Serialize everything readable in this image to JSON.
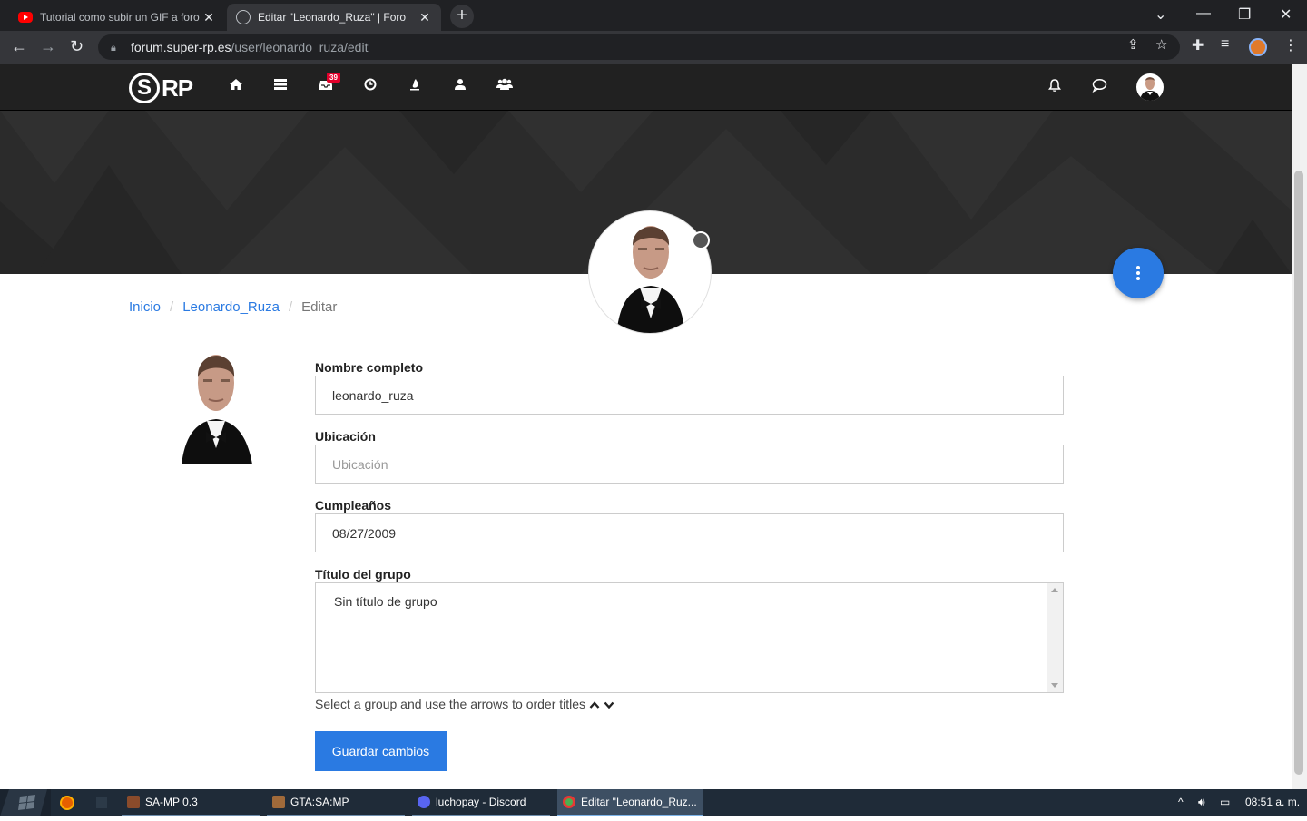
{
  "browser": {
    "tabs": [
      {
        "title": "Tutorial como subir un GIF a foro",
        "active": false
      },
      {
        "title": "Editar \"Leonardo_Ruza\" | Foro",
        "active": true
      }
    ],
    "url_host": "forum.super-rp.es",
    "url_path": "/user/leonardo_ruza/edit"
  },
  "header": {
    "logo_s": "S",
    "logo_rp": "RP",
    "notifications_badge": "39"
  },
  "breadcrumb": {
    "home": "Inicio",
    "user": "Leonardo_Ruza",
    "current": "Editar"
  },
  "form": {
    "fullname_label": "Nombre completo",
    "fullname_value": "leonardo_ruza",
    "location_label": "Ubicación",
    "location_placeholder": "Ubicación",
    "birthday_label": "Cumpleaños",
    "birthday_value": "08/27/2009",
    "group_title_label": "Título del grupo",
    "group_title_option": "Sin título de grupo",
    "group_help": "Select a group and use the arrows to order titles",
    "save_label": "Guardar cambios"
  },
  "taskbar": {
    "tasks": [
      {
        "label": "SA-MP 0.3"
      },
      {
        "label": "GTA:SA:MP"
      },
      {
        "label": "luchopay - Discord"
      },
      {
        "label": "Editar \"Leonardo_Ruz..."
      }
    ],
    "clock": "08:51 a. m."
  },
  "colors": {
    "accent": "#2a7ae2",
    "header_bg": "#212121",
    "cover_bg": "#2b2b2b"
  }
}
